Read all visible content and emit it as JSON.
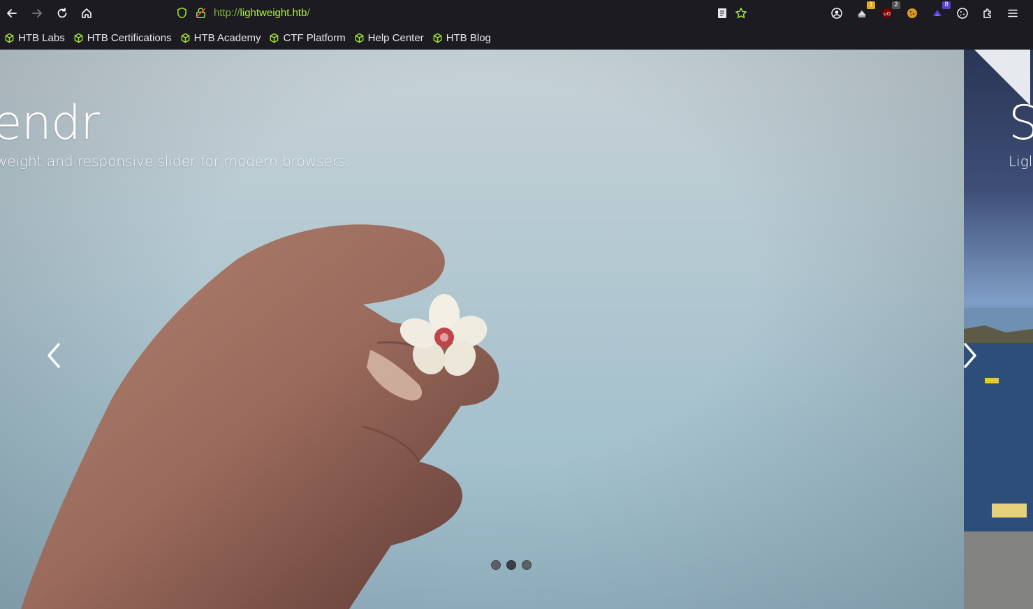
{
  "browser": {
    "url_scheme": "http://",
    "url_host": "lightweight.htb",
    "url_path": "/",
    "extensions": [
      {
        "icon": "extension-1-icon",
        "badge": "1",
        "badge_color": "#e8a81c"
      },
      {
        "icon": "ublock-icon",
        "badge": "2",
        "badge_color": "#555555"
      },
      {
        "icon": "cookie-icon",
        "badge": "",
        "badge_color": ""
      },
      {
        "icon": "extension-purple-icon",
        "badge": "8",
        "badge_color": "#5b3fd6"
      }
    ]
  },
  "bookmarks": [
    {
      "label": "HTB Labs"
    },
    {
      "label": "HTB Certifications"
    },
    {
      "label": "HTB Academy"
    },
    {
      "label": "CTF Platform"
    },
    {
      "label": "Help Center"
    },
    {
      "label": "HTB Blog"
    }
  ],
  "slider": {
    "current_title": "lendr",
    "current_subtitle": "tweight and responsive slider for modern browsers.",
    "next_title": "S",
    "next_subtitle": "Ligl",
    "dots_count": 3,
    "active_dot": 2
  },
  "colors": {
    "accent": "#a3e635",
    "toolbar_bg": "#1c1b22"
  }
}
